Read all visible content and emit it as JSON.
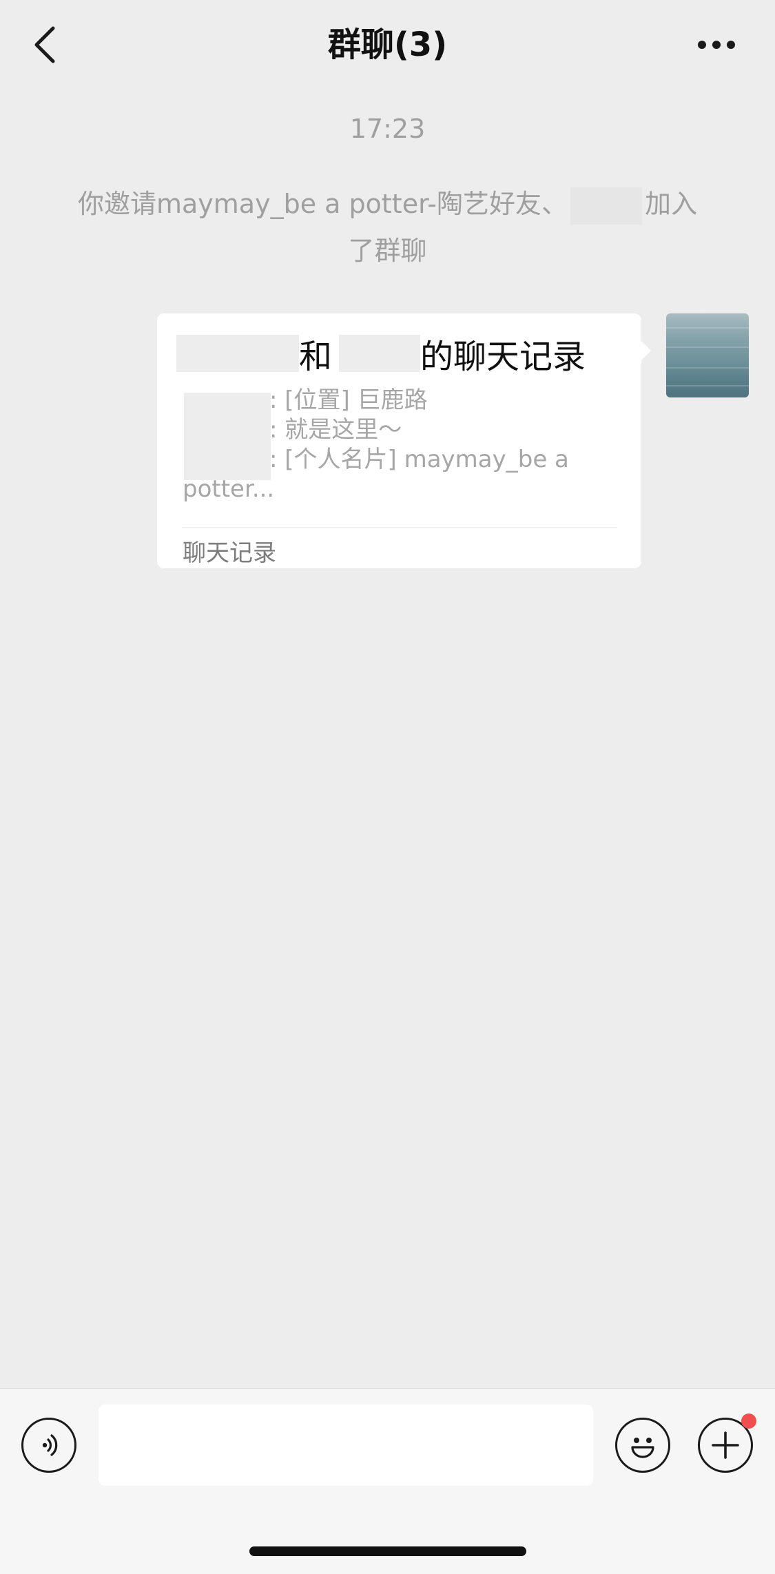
{
  "nav": {
    "title": "群聊(3)"
  },
  "conversation": {
    "timestamp": "17:23",
    "system_message_line1_before": "你邀请maymay_be a potter-陶艺好友、",
    "system_message_line1_after": "加入",
    "system_message_line2": "了群聊"
  },
  "chat_record_card": {
    "title_joiner": "和",
    "title_suffix": "的聊天记录",
    "preview_lines": [
      ": [位置] 巨鹿路",
      ": 就是这里～",
      ": [个人名片] maymay_be a"
    ],
    "preview_wrap": "potter...",
    "footer_label": "聊天记录"
  },
  "input": {
    "placeholder": ""
  },
  "icons": {
    "back": "chevron-left-icon",
    "more": "more-dots-icon",
    "voice": "voice-icon",
    "emoji": "emoji-icon",
    "plus": "plus-icon"
  },
  "colors": {
    "background": "#ededed",
    "bubble": "#ffffff",
    "badge": "#f04f4f"
  }
}
